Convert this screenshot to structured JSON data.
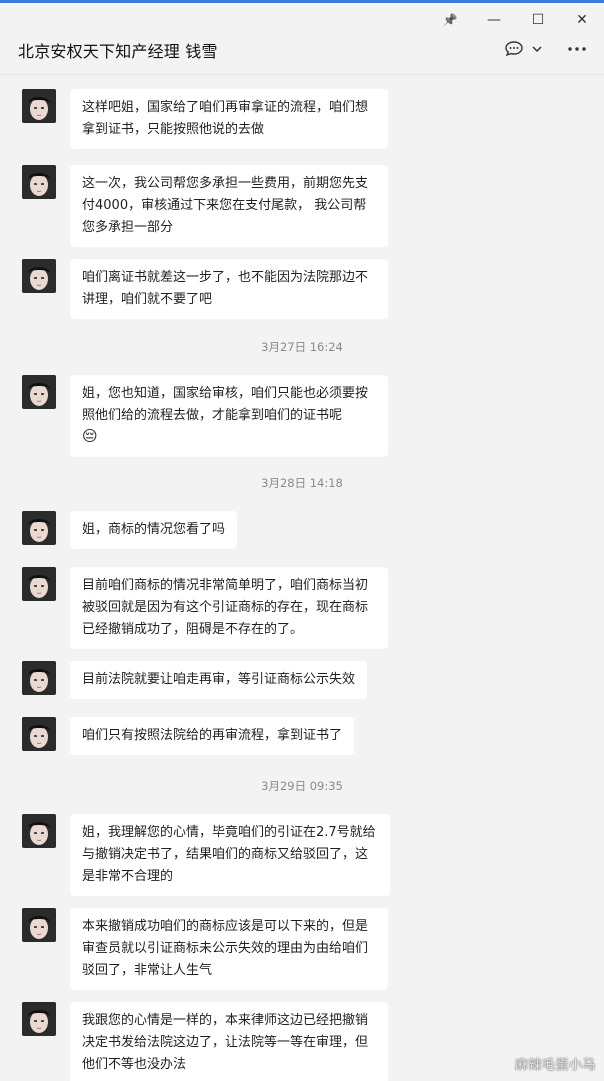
{
  "window": {
    "title": "北京安权天下知产经理 钱雪",
    "controls": {
      "pin": "📌",
      "minimize": "—",
      "maximize": "☐",
      "close": "✕"
    }
  },
  "header_actions": {
    "chat_icon": "💬",
    "chevron": "⌄",
    "more": "•••"
  },
  "messages": [
    {
      "text": "这样吧姐，国家给了咱们再审拿证的流程，咱们想拿到证书，只能按照他说的去做"
    },
    {
      "text": "这一次，我公司帮您多承担一些费用，前期您先支付4000，审核通过下来您在支付尾款， 我公司帮您多承担一部分"
    },
    {
      "text": "咱们离证书就差这一步了，也不能因为法院那边不讲理，咱们就不要了吧"
    },
    {
      "timestamp": "3月27日 16:24"
    },
    {
      "text": "姐，您也知道，国家给审核，咱们只能也必须要按照他们给的流程去做，才能拿到咱们的证书呢",
      "emoji": "😔"
    },
    {
      "timestamp": "3月28日 14:18"
    },
    {
      "text": "姐，商标的情况您看了吗"
    },
    {
      "text": "目前咱们商标的情况非常简单明了，咱们商标当初被驳回就是因为有这个引证商标的存在，现在商标已经撤销成功了，阻碍是不存在的了。"
    },
    {
      "text": "目前法院就要让咱走再审，等引证商标公示失效"
    },
    {
      "text": "咱们只有按照法院给的再审流程，拿到证书了"
    },
    {
      "timestamp": "3月29日 09:35"
    },
    {
      "text": "姐，我理解您的心情，毕竟咱们的引证在2.7号就给与撤销决定书了，结果咱们的商标又给驳回了，这是非常不合理的"
    },
    {
      "text": "本来撤销成功咱们的商标应该是可以下来的，但是审查员就以引证商标未公示失效的理由为由给咱们驳回了，非常让人生气"
    },
    {
      "text": "我跟您的心情是一样的，本来律师这边已经把撤销决定书发给法院这边了，让法院等一等在审理，但他们不等也没办法"
    }
  ],
  "watermark": "麻辣毛蛋小马"
}
